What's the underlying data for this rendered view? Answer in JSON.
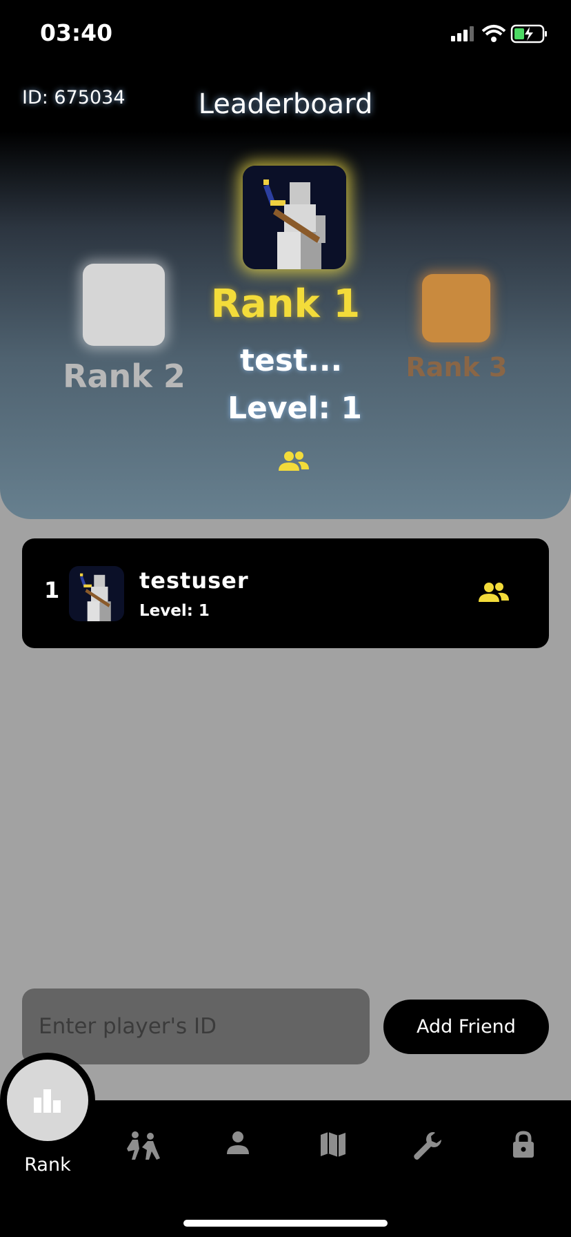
{
  "status_bar": {
    "time": "03:40"
  },
  "header": {
    "player_id": "ID: 675034",
    "title": "Leaderboard"
  },
  "podium": {
    "first": {
      "rank_label": "Rank 1",
      "name": "test...",
      "level": "Level: 1"
    },
    "second": {
      "rank_label": "Rank 2"
    },
    "third": {
      "rank_label": "Rank 3"
    }
  },
  "leaderboard": {
    "rows": [
      {
        "rank": "1",
        "name": "testuser",
        "level": "Level: 1"
      }
    ]
  },
  "add_friend": {
    "placeholder": "Enter player's ID",
    "button_label": "Add Friend"
  },
  "nav": {
    "items": [
      {
        "label": "Rank",
        "icon": "bar-chart-icon",
        "active": true
      },
      {
        "icon": "fighters-icon"
      },
      {
        "icon": "person-icon"
      },
      {
        "icon": "map-icon"
      },
      {
        "icon": "wrench-icon"
      },
      {
        "icon": "lock-icon"
      }
    ]
  },
  "colors": {
    "gold": "#f3dc3a",
    "silver": "#d6d6d6",
    "bronze": "#c98a3e",
    "friends_icon": "#f3dc3a"
  }
}
